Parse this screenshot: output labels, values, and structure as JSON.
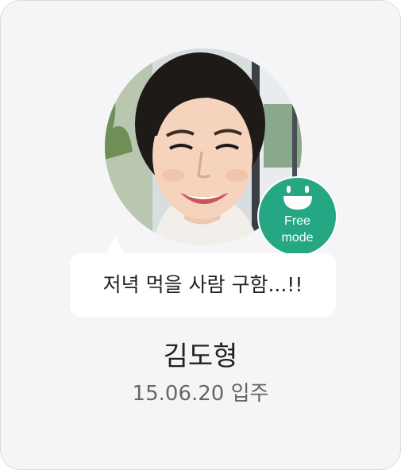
{
  "profile": {
    "mode_badge": {
      "icon": "smile-face-icon",
      "line1": "Free",
      "line2": "mode",
      "color": "#26a784"
    },
    "status_message": "저녁 먹을 사람 구함...!!",
    "name": "김도형",
    "move_in": "15.06.20 입주"
  }
}
